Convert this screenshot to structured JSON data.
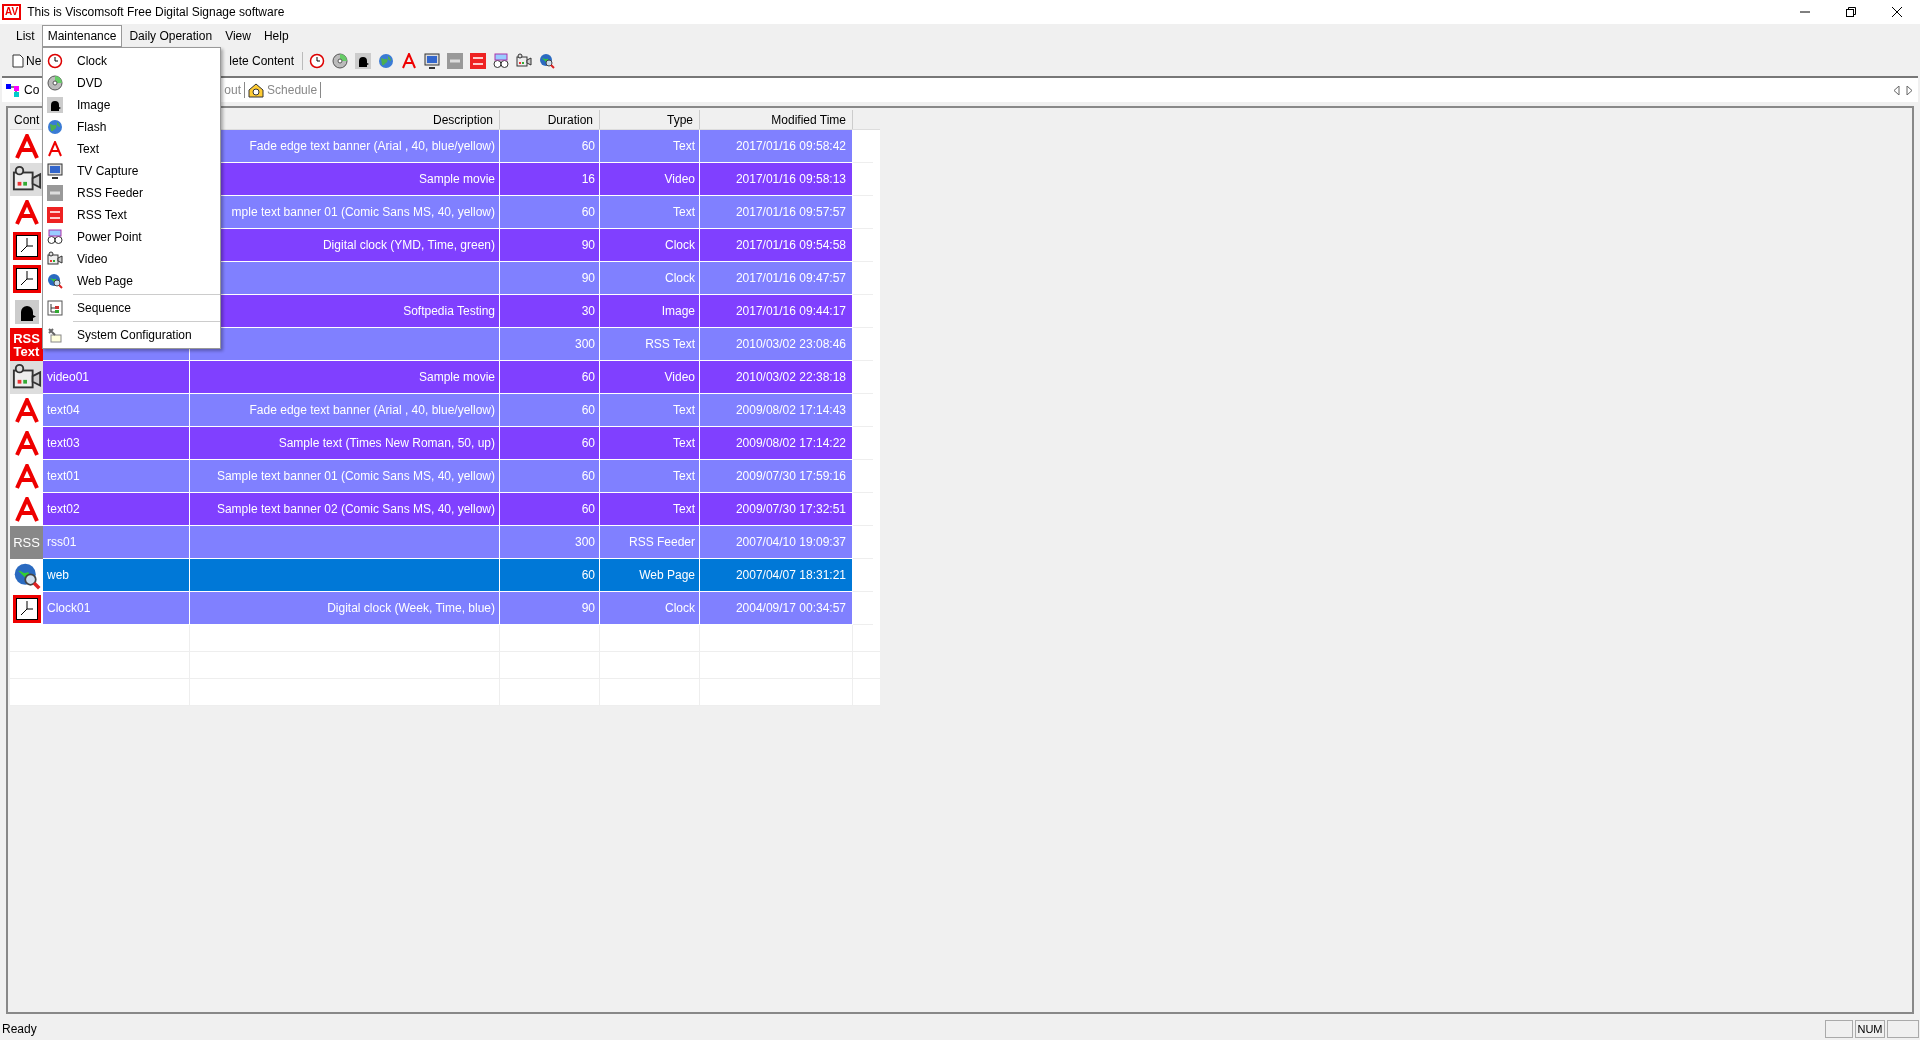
{
  "window": {
    "logo": "AV",
    "title": "This is Viscomsoft Free Digital Signage software"
  },
  "menu_bar": [
    {
      "label": "List",
      "selected": false
    },
    {
      "label": "Maintenance",
      "selected": true
    },
    {
      "label": "Daily Operation",
      "selected": false
    },
    {
      "label": "View",
      "selected": false
    },
    {
      "label": "Help",
      "selected": false
    }
  ],
  "toolbar": {
    "left_button": "Ne",
    "right_button": "lete Content"
  },
  "tabs": [
    {
      "label": "Co",
      "selected": true
    },
    {
      "label": "out",
      "selected": false
    },
    {
      "label": "Schedule",
      "selected": false
    }
  ],
  "table": {
    "columns": [
      "Cont",
      "Description",
      "Duration",
      "Type",
      "Modified Time"
    ],
    "rows": [
      {
        "kind": "text",
        "description": "Fade edge text banner (Arial , 40, blue/yellow)",
        "duration": "60",
        "type": "Text",
        "modified": "2017/01/16 09:58:42",
        "selected": false
      },
      {
        "kind": "video",
        "description": "Sample movie",
        "duration": "16",
        "type": "Video",
        "modified": "2017/01/16 09:58:13",
        "selected": false
      },
      {
        "kind": "text",
        "description": "mple text banner 01 (Comic Sans MS, 40, yellow)",
        "duration": "60",
        "type": "Text",
        "modified": "2017/01/16 09:57:57",
        "selected": false
      },
      {
        "kind": "clock",
        "description": "Digital clock (YMD, Time, green)",
        "duration": "90",
        "type": "Clock",
        "modified": "2017/01/16 09:54:58",
        "selected": false
      },
      {
        "kind": "clock",
        "duration": "90",
        "type": "Clock",
        "modified": "2017/01/16 09:47:57",
        "selected": false
      },
      {
        "kind": "image",
        "description": "Softpedia Testing",
        "duration": "30",
        "type": "Image",
        "modified": "2017/01/16 09:44:17",
        "selected": false
      },
      {
        "kind": "rsstext",
        "icon_label": [
          "RSS",
          "Text"
        ],
        "duration": "300",
        "type": "RSS Text",
        "modified": "2010/03/02 23:08:46",
        "selected": false
      },
      {
        "kind": "video",
        "name": "video01",
        "description": "Sample movie",
        "duration": "60",
        "type": "Video",
        "modified": "2010/03/02 22:38:18",
        "selected": false
      },
      {
        "kind": "text",
        "name": "text04",
        "description": "Fade edge text banner (Arial , 40, blue/yellow)",
        "duration": "60",
        "type": "Text",
        "modified": "2009/08/02 17:14:43",
        "selected": false
      },
      {
        "kind": "text",
        "name": "text03",
        "description": "Sample text (Times New Roman, 50, up)",
        "duration": "60",
        "type": "Text",
        "modified": "2009/08/02 17:14:22",
        "selected": false
      },
      {
        "kind": "text",
        "name": "text01",
        "description": "Sample text banner 01 (Comic Sans MS, 40, yellow)",
        "duration": "60",
        "type": "Text",
        "modified": "2009/07/30 17:59:16",
        "selected": false
      },
      {
        "kind": "text",
        "name": "text02",
        "description": "Sample text banner 02 (Comic Sans MS, 40, yellow)",
        "duration": "60",
        "type": "Text",
        "modified": "2009/07/30 17:32:51",
        "selected": false
      },
      {
        "kind": "rss",
        "icon_label": [
          "RSS"
        ],
        "name": "rss01",
        "duration": "300",
        "type": "RSS Feeder",
        "modified": "2007/04/10 19:09:37",
        "selected": false
      },
      {
        "kind": "web",
        "name": "web",
        "duration": "60",
        "type": "Web Page",
        "modified": "2007/04/07 18:31:21",
        "selected": true
      },
      {
        "kind": "clock",
        "name": "Clock01",
        "description": "Digital clock (Week, Time, blue)",
        "duration": "90",
        "type": "Clock",
        "modified": "2004/09/17 00:34:57",
        "selected": false
      }
    ]
  },
  "dropdown": [
    {
      "kind": "item",
      "label": "Clock"
    },
    {
      "kind": "item",
      "label": "DVD"
    },
    {
      "kind": "item",
      "label": "Image"
    },
    {
      "kind": "item",
      "label": "Flash"
    },
    {
      "kind": "item",
      "label": "Text"
    },
    {
      "kind": "item",
      "label": "TV Capture"
    },
    {
      "kind": "item",
      "label": "RSS Feeder"
    },
    {
      "kind": "item",
      "label": "RSS Text"
    },
    {
      "kind": "item",
      "label": "Power Point"
    },
    {
      "kind": "item",
      "label": "Video"
    },
    {
      "kind": "item",
      "label": "Web Page"
    },
    {
      "kind": "separator"
    },
    {
      "kind": "item",
      "label": "Sequence"
    },
    {
      "kind": "separator"
    },
    {
      "kind": "item",
      "label": "System Configuration"
    }
  ],
  "status_bar": {
    "text": "Ready",
    "indicator": "NUM"
  }
}
